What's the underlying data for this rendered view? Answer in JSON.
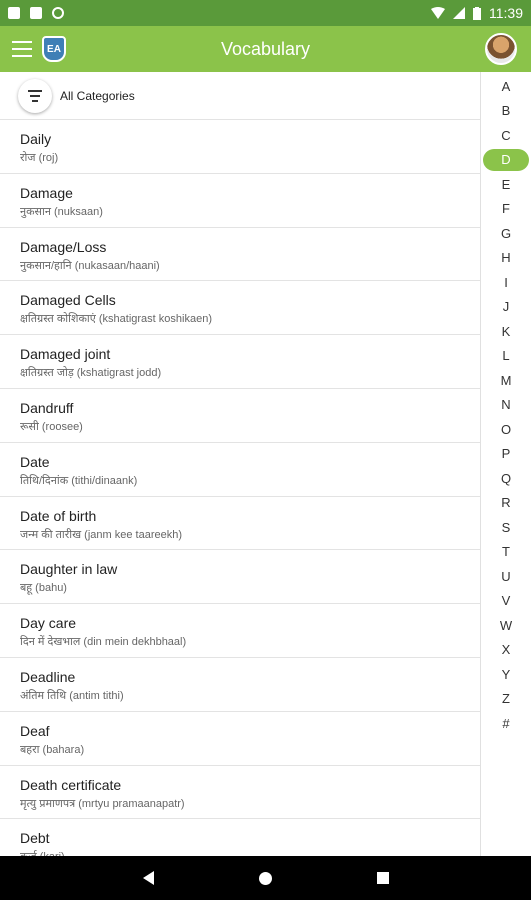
{
  "status_bar": {
    "time": "11:39"
  },
  "app_bar": {
    "title": "Vocabulary",
    "logo_text": "EA"
  },
  "filter": {
    "label": "All Categories"
  },
  "vocab": [
    {
      "term": "Daily",
      "translation": "रोज (roj)"
    },
    {
      "term": "Damage",
      "translation": "नुकसान (nuksaan)"
    },
    {
      "term": "Damage/Loss",
      "translation": "नुकसान/हानि (nukasaan/haani)"
    },
    {
      "term": "Damaged Cells",
      "translation": "क्षतिग्रस्त कोशिकाएं (kshatigrast koshikaen)"
    },
    {
      "term": "Damaged joint",
      "translation": "क्षतिग्रस्त जोड़ (kshatigrast jodd)"
    },
    {
      "term": "Dandruff",
      "translation": "रूसी (roosee)"
    },
    {
      "term": "Date",
      "translation": "तिथि/दिनांक (tithi/dinaank)"
    },
    {
      "term": "Date of birth",
      "translation": "जन्म की तारीख (janm kee taareekh)"
    },
    {
      "term": "Daughter in law",
      "translation": "बहू (bahu)"
    },
    {
      "term": "Day care",
      "translation": "दिन में देखभाल (din mein dekhbhaal)"
    },
    {
      "term": "Deadline",
      "translation": "अंतिम तिथि (antim tithi)"
    },
    {
      "term": "Deaf",
      "translation": "बहरा (bahara)"
    },
    {
      "term": "Death certificate",
      "translation": "मृत्यु प्रमाणपत्र (mrtyu pramaanapatr)"
    },
    {
      "term": "Debt",
      "translation": "कर्ज (karj)"
    }
  ],
  "alphabet": [
    "A",
    "B",
    "C",
    "D",
    "E",
    "F",
    "G",
    "H",
    "I",
    "J",
    "K",
    "L",
    "M",
    "N",
    "O",
    "P",
    "Q",
    "R",
    "S",
    "T",
    "U",
    "V",
    "W",
    "X",
    "Y",
    "Z",
    "#"
  ],
  "alphabet_selected": "D",
  "colors": {
    "app_bar": "#8bc34a",
    "status_bar": "#5a9a3a",
    "accent": "#8bc34a"
  }
}
